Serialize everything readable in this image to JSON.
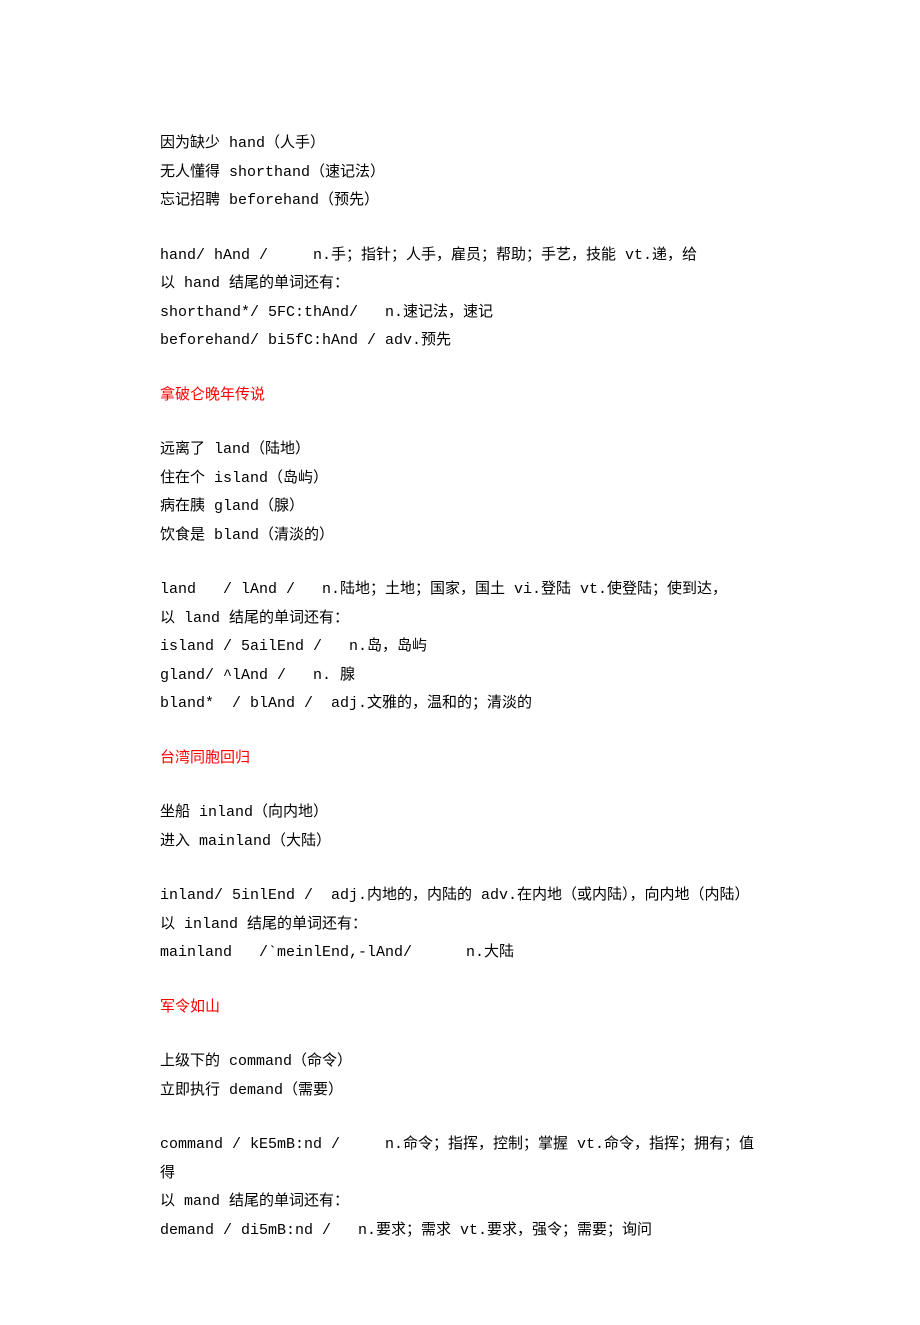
{
  "section1": {
    "lines": [
      "因为缺少 hand（人手）",
      "无人懂得 shorthand（速记法）",
      "忘记招聘 beforehand（预先）"
    ],
    "defs": [
      "hand/ hAnd /     n.手；指针；人手，雇员；帮助；手艺，技能 vt.递，给",
      "以 hand 结尾的单词还有：",
      "shorthand*/ 5FC:thAnd/   n.速记法，速记",
      "beforehand/ bi5fC:hAnd / adv.预先"
    ]
  },
  "section2": {
    "heading": "拿破仑晚年传说",
    "lines": [
      "远离了 land（陆地）",
      "住在个 island（岛屿）",
      "病在胰 gland（腺）",
      "饮食是 bland（清淡的）"
    ],
    "defs": [
      "land   / lAnd /   n.陆地；土地；国家，国土 vi.登陆 vt.使登陆；使到达，",
      "以 land 结尾的单词还有：",
      "island / 5ailEnd /   n.岛，岛屿",
      "gland/ ^lAnd /   n. 腺",
      "bland*  / blAnd /  adj.文雅的，温和的；清淡的"
    ]
  },
  "section3": {
    "heading": "台湾同胞回归",
    "lines": [
      "坐船 inland（向内地）",
      "进入 mainland（大陆）"
    ],
    "defs": [
      "inland/ 5inlEnd /  adj.内地的，内陆的 adv.在内地（或内陆），向内地（内陆）",
      "以 inland 结尾的单词还有：",
      "mainland   /`meinlEnd,-lAnd/      n.大陆"
    ]
  },
  "section4": {
    "heading": "军令如山",
    "lines": [
      "上级下的 command（命令）",
      "立即执行 demand（需要）"
    ],
    "defs": [
      "command / kE5mB:nd /     n.命令；指挥，控制；掌握 vt.命令，指挥；拥有；值得",
      "以 mand 结尾的单词还有：",
      "demand / di5mB:nd /   n.要求；需求 vt.要求，强令；需要；询问"
    ]
  }
}
